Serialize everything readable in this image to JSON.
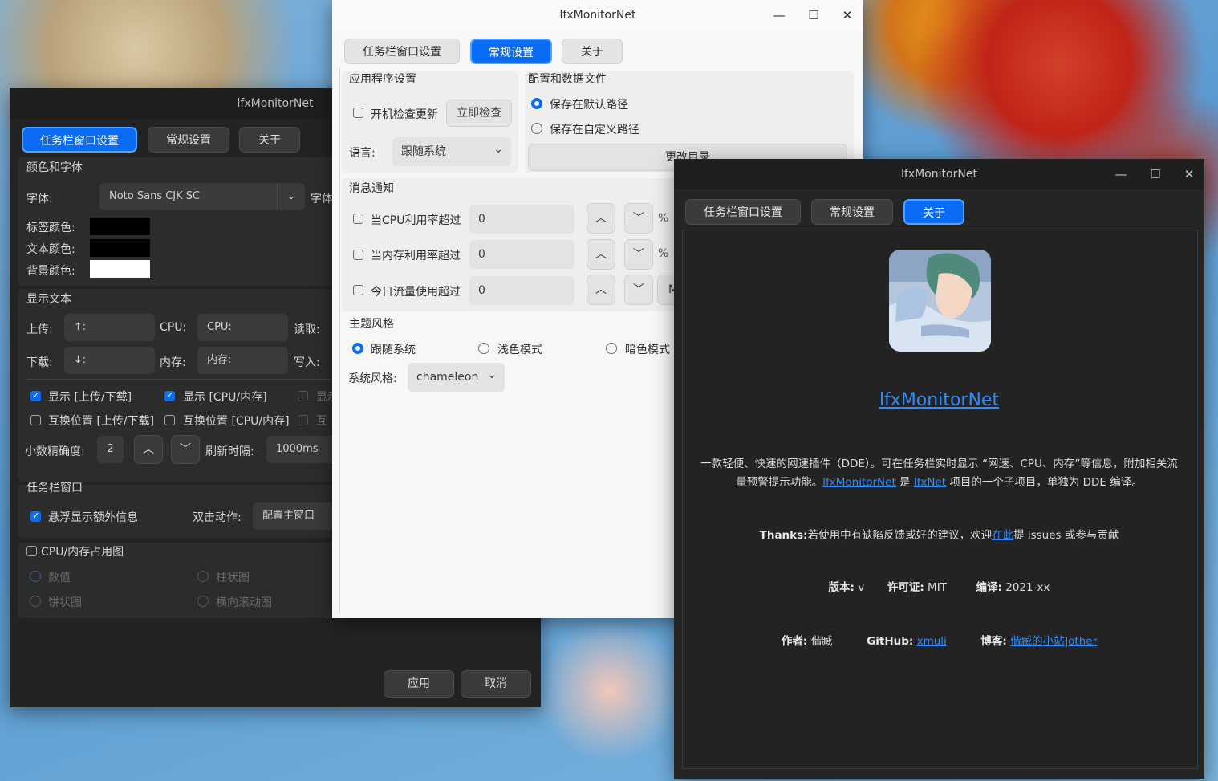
{
  "app_title": "lfxMonitorNet",
  "tabs": {
    "taskbar": "任务栏窗口设置",
    "general": "常规设置",
    "about": "关于"
  },
  "colors": {
    "accent": "#0a6cf5",
    "link": "#2f8cff",
    "dark_bg": "#232323",
    "light_bg": "#f7f7f7"
  },
  "dark_window": {
    "section_color_font": "颜色和字体",
    "font_label": "字体:",
    "font_value": "Noto Sans CJK SC",
    "font_label2": "字体",
    "label_color": "标签颜色:",
    "text_color": "文本颜色:",
    "bg_color": "背景颜色:",
    "label_color_value": "#000000",
    "text_color_value": "#000000",
    "bg_color_value": "#ffffff",
    "section_display_text": "显示文本",
    "upload_label": "上传:",
    "upload_value": "↑:",
    "cpu_label": "CPU:",
    "cpu_value": "CPU:",
    "read_label": "读取:",
    "download_label": "下载:",
    "download_value": "↓:",
    "mem_label": "内存:",
    "mem_value": "内存:",
    "write_label": "写入:",
    "show_updown": "显示 [上传/下载]",
    "show_cpumem": "显示 [CPU/内存]",
    "show_more": "显示",
    "swap_updown": "互换位置 [上传/下载]",
    "swap_cpumem": "互换位置 [CPU/内存]",
    "swap_more": "互",
    "decimal_label": "小数精确度:",
    "decimal_value": "2",
    "refresh_label": "刷新时隔:",
    "refresh_value": "1000ms",
    "section_taskbar": "任务栏窗口",
    "hover_info": "悬浮显示额外信息",
    "dblclick_label": "双击动作:",
    "dblclick_value": "配置主窗口",
    "chart_label": "CPU/内存占用图",
    "opt_number": "数值",
    "opt_bar": "柱状图",
    "opt_pie": "饼状图",
    "opt_scroll": "横向滚动图",
    "apply": "应用",
    "cancel": "取消"
  },
  "light_window": {
    "section_app": "应用程序设置",
    "check_update": "开机检查更新",
    "check_now": "立即检查",
    "language_label": "语言:",
    "language_value": "跟随系统",
    "section_config": "配置和数据文件",
    "save_default": "保存在默认路径",
    "save_custom": "保存在自定义路径",
    "change_dir": "更改目录",
    "section_notify": "消息通知",
    "cpu_over": "当CPU利用率超过",
    "mem_over": "当内存利用率超过",
    "traffic_over": "今日流量使用超过",
    "cpu_over_value": "0",
    "mem_over_value": "0",
    "traffic_over_value": "0",
    "percent": "%",
    "unit_m": "M",
    "section_theme": "主题风格",
    "theme_follow": "跟随系统",
    "theme_light": "浅色模式",
    "theme_dark": "暗色模式",
    "style_label": "系统风格:",
    "style_value": "chameleon"
  },
  "about_window": {
    "app_name": "lfxMonitorNet",
    "desc_line1": "一款轻便、快速的网速插件（DDE）。可在任务栏实时显示 “网速、CPU、内存”等信息，附加相关流",
    "desc_line2_pre": "量预警提示功能。",
    "desc_link1": "lfxMonitorNet",
    "desc_mid": " 是 ",
    "desc_link2": "lfxNet",
    "desc_post": " 项目的一个子项目，单独为 DDE 编译。",
    "thanks_label": "Thanks:",
    "thanks_text": "若使用中有缺陷反馈或好的建议，欢迎",
    "thanks_link": "在此",
    "thanks_tail": "提 issues 或参与贡献",
    "version_label": "版本:",
    "version_value": "v",
    "license_label": "许可证:",
    "license_value": "MIT",
    "build_label": "编译:",
    "build_value": "2021-xx",
    "author_label": "作者:",
    "author_value": "偕臧",
    "github_label": "GitHub:",
    "github_value": "xmuli",
    "blog_label": "博客:",
    "blog_value": "偕臧的小站",
    "blog_sep": "|",
    "blog_other": "other"
  }
}
